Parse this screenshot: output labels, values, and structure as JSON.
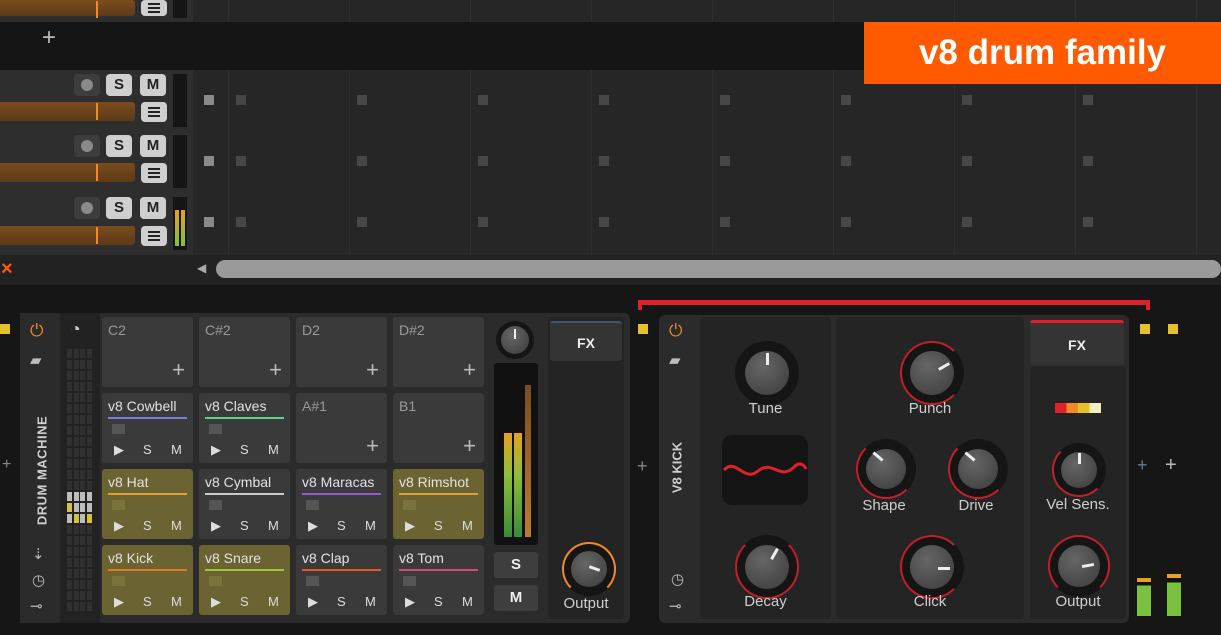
{
  "overlay": {
    "title": "v8 drum family"
  },
  "tracks": [
    {
      "solo": "S",
      "mute": "M"
    },
    {
      "solo": "S",
      "mute": "M"
    },
    {
      "solo": "S",
      "mute": "M"
    }
  ],
  "add_track": "+",
  "close_icon": "×",
  "scroll_left": "◀",
  "drum_machine": {
    "title": "DRUM MACHINE",
    "pads": [
      {
        "name": "C2",
        "type": "empty"
      },
      {
        "name": "C#2",
        "type": "empty"
      },
      {
        "name": "D2",
        "type": "empty"
      },
      {
        "name": "D#2",
        "type": "empty"
      },
      {
        "name": "v8 Cowbell",
        "type": "filled",
        "color": "#7a7fd6"
      },
      {
        "name": "v8 Claves",
        "type": "filled",
        "color": "#5fd18a"
      },
      {
        "name": "A#1",
        "type": "empty"
      },
      {
        "name": "B1",
        "type": "empty"
      },
      {
        "name": "v8 Hat",
        "type": "hl",
        "color": "#e0a030"
      },
      {
        "name": "v8 Cymbal",
        "type": "filled",
        "color": "#c9c9c9"
      },
      {
        "name": "v8 Maracas",
        "type": "filled",
        "color": "#9a55d6"
      },
      {
        "name": "v8 Rimshot",
        "type": "hl",
        "color": "#e0a030"
      },
      {
        "name": "v8 Kick",
        "type": "hl",
        "color": "#e07a2a"
      },
      {
        "name": "v8 Snare",
        "type": "hl",
        "color": "#a8c040"
      },
      {
        "name": "v8 Clap",
        "type": "filled",
        "color": "#e05a2a"
      },
      {
        "name": "v8 Tom",
        "type": "filled",
        "color": "#d04a7a"
      }
    ],
    "pad_play": "▶",
    "pad_solo": "S",
    "pad_mute": "M",
    "pad_add": "+",
    "solo": "S",
    "mute": "M",
    "fx": "FX",
    "output_label": "Output"
  },
  "kick": {
    "title": "V8 KICK",
    "fx": "FX",
    "knobs": {
      "tune": "Tune",
      "decay": "Decay",
      "punch": "Punch",
      "shape": "Shape",
      "drive": "Drive",
      "click": "Click",
      "vel_sens": "Vel Sens.",
      "output": "Output"
    }
  },
  "add_device": "+",
  "colors": {
    "accent": "#ff5a00",
    "orange": "#f08a24",
    "red": "#e0202a",
    "yellow": "#e6c229"
  }
}
